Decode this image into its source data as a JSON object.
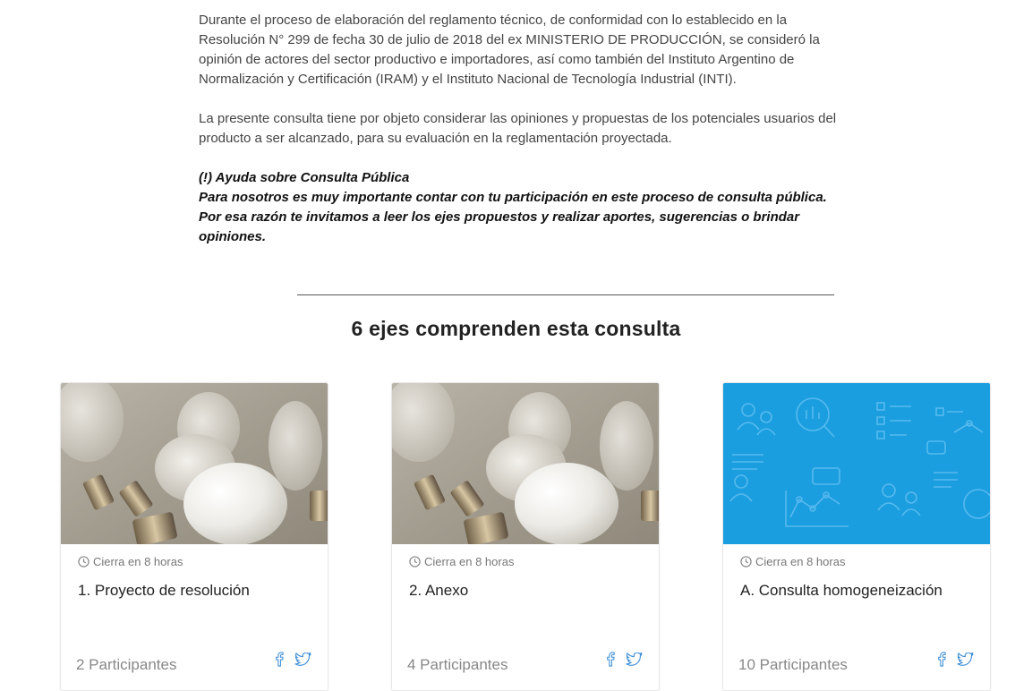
{
  "intro": {
    "paragraph1": "Durante el proceso de elaboración del reglamento técnico, de conformidad con lo establecido en la Resolución N° 299 de fecha 30 de julio de 2018 del ex MINISTERIO DE PRODUCCIÓN, se consideró la opinión de actores del sector productivo e importadores, así como también del Instituto Argentino de Normalización y Certificación (IRAM) y el Instituto Nacional de Tecnología Industrial (INTI).",
    "paragraph2": "La presente consulta tiene por objeto considerar las opiniones y propuestas de los potenciales usuarios del producto a ser alcanzado, para su evaluación en la reglamentación proyectada.",
    "help_title": "(!) Ayuda sobre Consulta Pública",
    "help_line1": "Para nosotros es muy importante contar con tu participación en este proceso de consulta pública.",
    "help_line2": "Por esa razón te invitamos a leer los ejes propuestos y realizar aportes, sugerencias o brindar opiniones."
  },
  "section": {
    "title": "6 ejes comprenden esta consulta"
  },
  "cards": [
    {
      "closes": "Cierra en 8 horas",
      "title": "1. Proyecto de resolución",
      "participants": "2 Participantes",
      "image": "light-bulbs-photo"
    },
    {
      "closes": "Cierra en 8 horas",
      "title": "2. Anexo",
      "participants": "4 Participantes",
      "image": "light-bulbs-photo"
    },
    {
      "closes": "Cierra en 8 horas",
      "title": "A. Consulta homogeneización",
      "participants": "10 Participantes",
      "image": "blue-icons-pattern"
    }
  ],
  "colors": {
    "accent_blue": "#1a9ee0",
    "facebook": "#3b8ed8",
    "twitter": "#3b8ed8"
  }
}
